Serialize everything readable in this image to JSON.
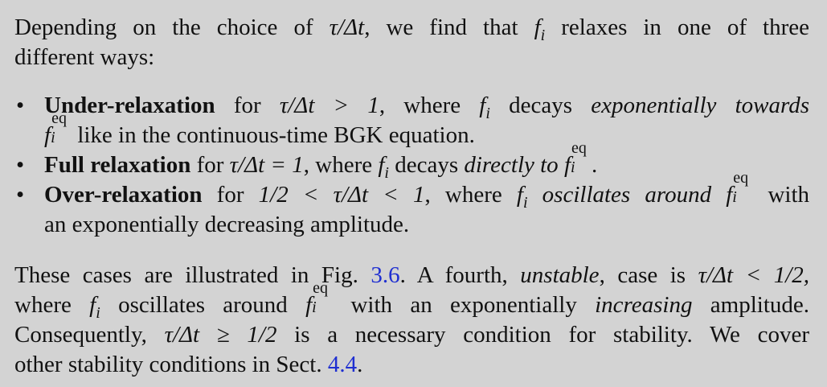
{
  "intro": {
    "line1": {
      "a": "Depending on the choice of",
      "tau": "τ/Δ",
      "t": "t",
      "b": ", we find that",
      "f": "f",
      "i": "i",
      "c": "relaxes in one of three"
    },
    "line2": "different ways:"
  },
  "bullets": [
    {
      "bullet_glyph": "•",
      "term": "Under-relaxation",
      "for": "for",
      "cond": "τ/Δt > 1",
      "where": ", where",
      "decays": "decays",
      "em": "exponentially towards",
      "tail": "like in the continuous-time BGK equation."
    },
    {
      "bullet_glyph": "•",
      "term": "Full relaxation",
      "for": "for",
      "cond": "τ/Δt = 1",
      "where": ", where",
      "decays": "decays",
      "em": "directly to",
      "tail": "."
    },
    {
      "bullet_glyph": "•",
      "term": "Over-relaxation",
      "for": "for",
      "cond": "1/2 < τ/Δt < 1",
      "where": ", where",
      "em": "oscillates around",
      "tail1": "with",
      "tail2": "an exponentially decreasing amplitude."
    }
  ],
  "outro": {
    "l1a": "These cases are illustrated in Fig.",
    "fig_ref": "3.6",
    "l1b": ". A fourth,",
    "unstable": "unstable",
    "l1c": ", case is",
    "cond1": "τ/Δt < 1/2,",
    "l2a": "where",
    "l2b": "oscillates around",
    "l2c": "with an exponentially",
    "increasing": "increasing",
    "l2d": "amplitude.",
    "l3a": "Consequently,",
    "cond2": "τ/Δt ≥ 1/2",
    "l3b": "is a necessary condition for stability. We cover",
    "l4a": "other stability conditions in Sect.",
    "sect_ref": "4.4",
    "l4b": "."
  },
  "symbols": {
    "f": "f",
    "i": "i",
    "eq": "eq"
  },
  "colors": {
    "background": "#d3d3d3",
    "text": "#111111",
    "link": "#1f2fd1"
  }
}
